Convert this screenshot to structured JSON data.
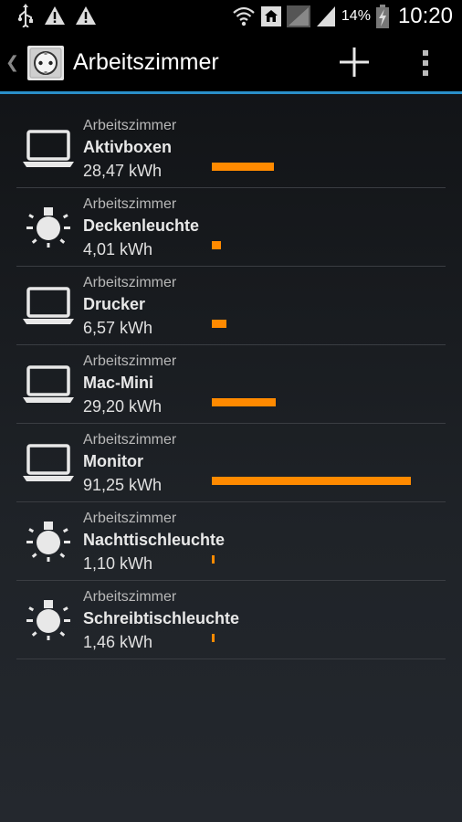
{
  "status": {
    "battery": "14%",
    "time": "10:20"
  },
  "header": {
    "title": "Arbeitszimmer"
  },
  "colors": {
    "accent": "#2a8fc8",
    "bar": "#ff8a00"
  },
  "devices": [
    {
      "room": "Arbeitszimmer",
      "name": "Aktivboxen",
      "kwh": "28,47 kWh",
      "icon": "laptop-icon",
      "share": 0.312
    },
    {
      "room": "Arbeitszimmer",
      "name": "Deckenleuchte",
      "kwh": "4,01 kWh",
      "icon": "lightbulb-icon",
      "share": 0.044
    },
    {
      "room": "Arbeitszimmer",
      "name": "Drucker",
      "kwh": "6,57 kWh",
      "icon": "laptop-icon",
      "share": 0.072
    },
    {
      "room": "Arbeitszimmer",
      "name": "Mac-Mini",
      "kwh": "29,20 kWh",
      "icon": "laptop-icon",
      "share": 0.32
    },
    {
      "room": "Arbeitszimmer",
      "name": "Monitor",
      "kwh": "91,25 kWh",
      "icon": "laptop-icon",
      "share": 1.0
    },
    {
      "room": "Arbeitszimmer",
      "name": "Nachttischleuchte",
      "kwh": "1,10 kWh",
      "icon": "lightbulb-icon",
      "share": 0.012
    },
    {
      "room": "Arbeitszimmer",
      "name": "Schreibtischleuchte",
      "kwh": "1,46 kWh",
      "icon": "lightbulb-icon",
      "share": 0.016
    }
  ]
}
